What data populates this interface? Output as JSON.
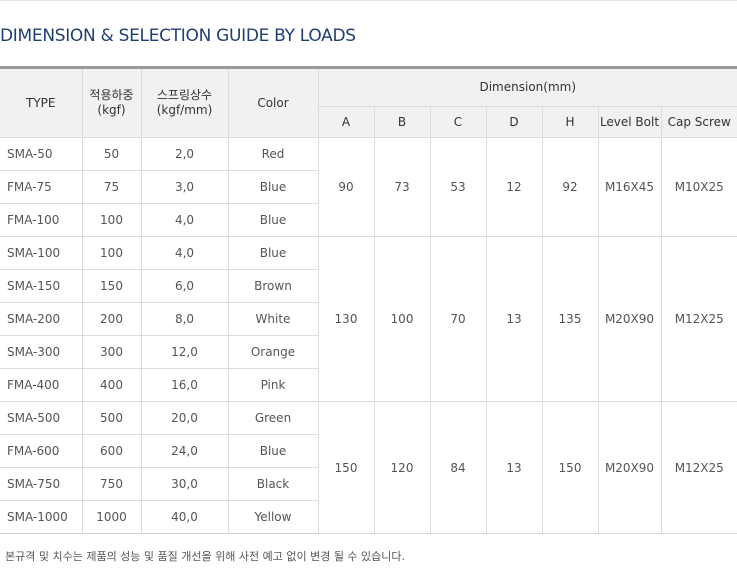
{
  "title": "DIMENSION & SELECTION GUIDE BY LOADS",
  "headers": {
    "type": "TYPE",
    "load": [
      "적용하중",
      "(kgf)"
    ],
    "spring": [
      "스프링상수",
      "(kgf/mm)"
    ],
    "color": "Color",
    "dimension": "Dimension(mm)",
    "dims": [
      "A",
      "B",
      "C",
      "D",
      "H",
      "Level Bolt",
      "Cap Screw"
    ]
  },
  "rows": [
    [
      "SMA-50",
      "50",
      "2,0",
      "Red"
    ],
    [
      "FMA-75",
      "75",
      "3,0",
      "Blue"
    ],
    [
      "FMA-100",
      "100",
      "4,0",
      "Blue"
    ],
    [
      "SMA-100",
      "100",
      "4,0",
      "Blue"
    ],
    [
      "SMA-150",
      "150",
      "6,0",
      "Brown"
    ],
    [
      "SMA-200",
      "200",
      "8,0",
      "White"
    ],
    [
      "SMA-300",
      "300",
      "12,0",
      "Orange"
    ],
    [
      "FMA-400",
      "400",
      "16,0",
      "Pink"
    ],
    [
      "SMA-500",
      "500",
      "20,0",
      "Green"
    ],
    [
      "FMA-600",
      "600",
      "24,0",
      "Blue"
    ],
    [
      "SMA-750",
      "750",
      "30,0",
      "Black"
    ],
    [
      "SMA-1000",
      "1000",
      "40,0",
      "Yellow"
    ]
  ],
  "groups": [
    {
      "span": 3,
      "dims": [
        "90",
        "73",
        "53",
        "12",
        "92",
        "M16X45",
        "M10X25"
      ]
    },
    {
      "span": 5,
      "dims": [
        "130",
        "100",
        "70",
        "13",
        "135",
        "M20X90",
        "M12X25"
      ]
    },
    {
      "span": 4,
      "dims": [
        "150",
        "120",
        "84",
        "13",
        "150",
        "M20X90",
        "M12X25"
      ]
    }
  ],
  "note": "본규격 및 치수는 제품의 성능 및 품질 개선을 위해 사전 예고 없이 변경 될 수 있습니다."
}
